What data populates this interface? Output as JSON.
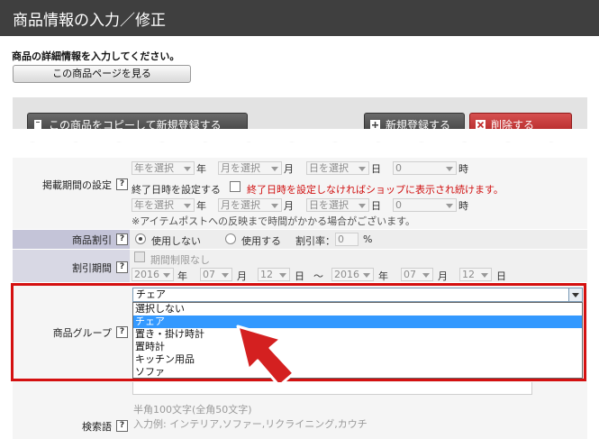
{
  "header": {
    "title": "商品情報の入力／修正"
  },
  "intro": {
    "text": "商品の詳細情報を入力してください。",
    "view_button": "この商品ページを見る"
  },
  "toolbar": {
    "copy_button": "この商品をコピーして新規登録する",
    "new_button": "新規登録する",
    "delete_button": "削除する"
  },
  "units": {
    "year": "年",
    "month": "月",
    "day": "日",
    "hour": "時",
    "tilde": "～"
  },
  "period": {
    "label": "掲載期間の設定",
    "year_placeholder": "年を選択",
    "month_placeholder": "月を選択",
    "day_placeholder": "日を選択",
    "hour_value": "0",
    "end_checkbox_label": "終了日時を設定する",
    "end_warning": "終了日時を設定しなければショップに表示され続けます。",
    "note": "※アイテムポストへの反映まで時間がかかる場合がございます。"
  },
  "discount": {
    "label": "商品割引",
    "option_no": "使用しない",
    "option_yes": "使用する",
    "rate_label": "割引率：",
    "rate_value": "0",
    "percent": "%"
  },
  "discount_period": {
    "label": "割引期間",
    "no_limit_label": "期間制限なし",
    "start": {
      "year": "2016",
      "month": "07",
      "day": "12"
    },
    "end": {
      "year": "2016",
      "month": "07",
      "day": "12"
    }
  },
  "group": {
    "label": "商品グループ",
    "selected": "チェア",
    "options": [
      "選択しない",
      "チェア",
      "置き・掛け時計",
      "置時計",
      "キッチン用品",
      "ソファ"
    ],
    "highlighted_index": 1
  },
  "keyword": {
    "label": "検索語",
    "hint1": "半角100文字(全角50文字)",
    "hint2": "入力例: インテリア,ソファー,リクライニング,カウチ"
  },
  "help_icon_text": "?",
  "colors": {
    "header_bg": "#3f3f3f",
    "delete_red": "#c22a2a",
    "highlight_red": "#d41010",
    "selection_blue": "#3399ff",
    "arrow_red": "#d42020"
  }
}
